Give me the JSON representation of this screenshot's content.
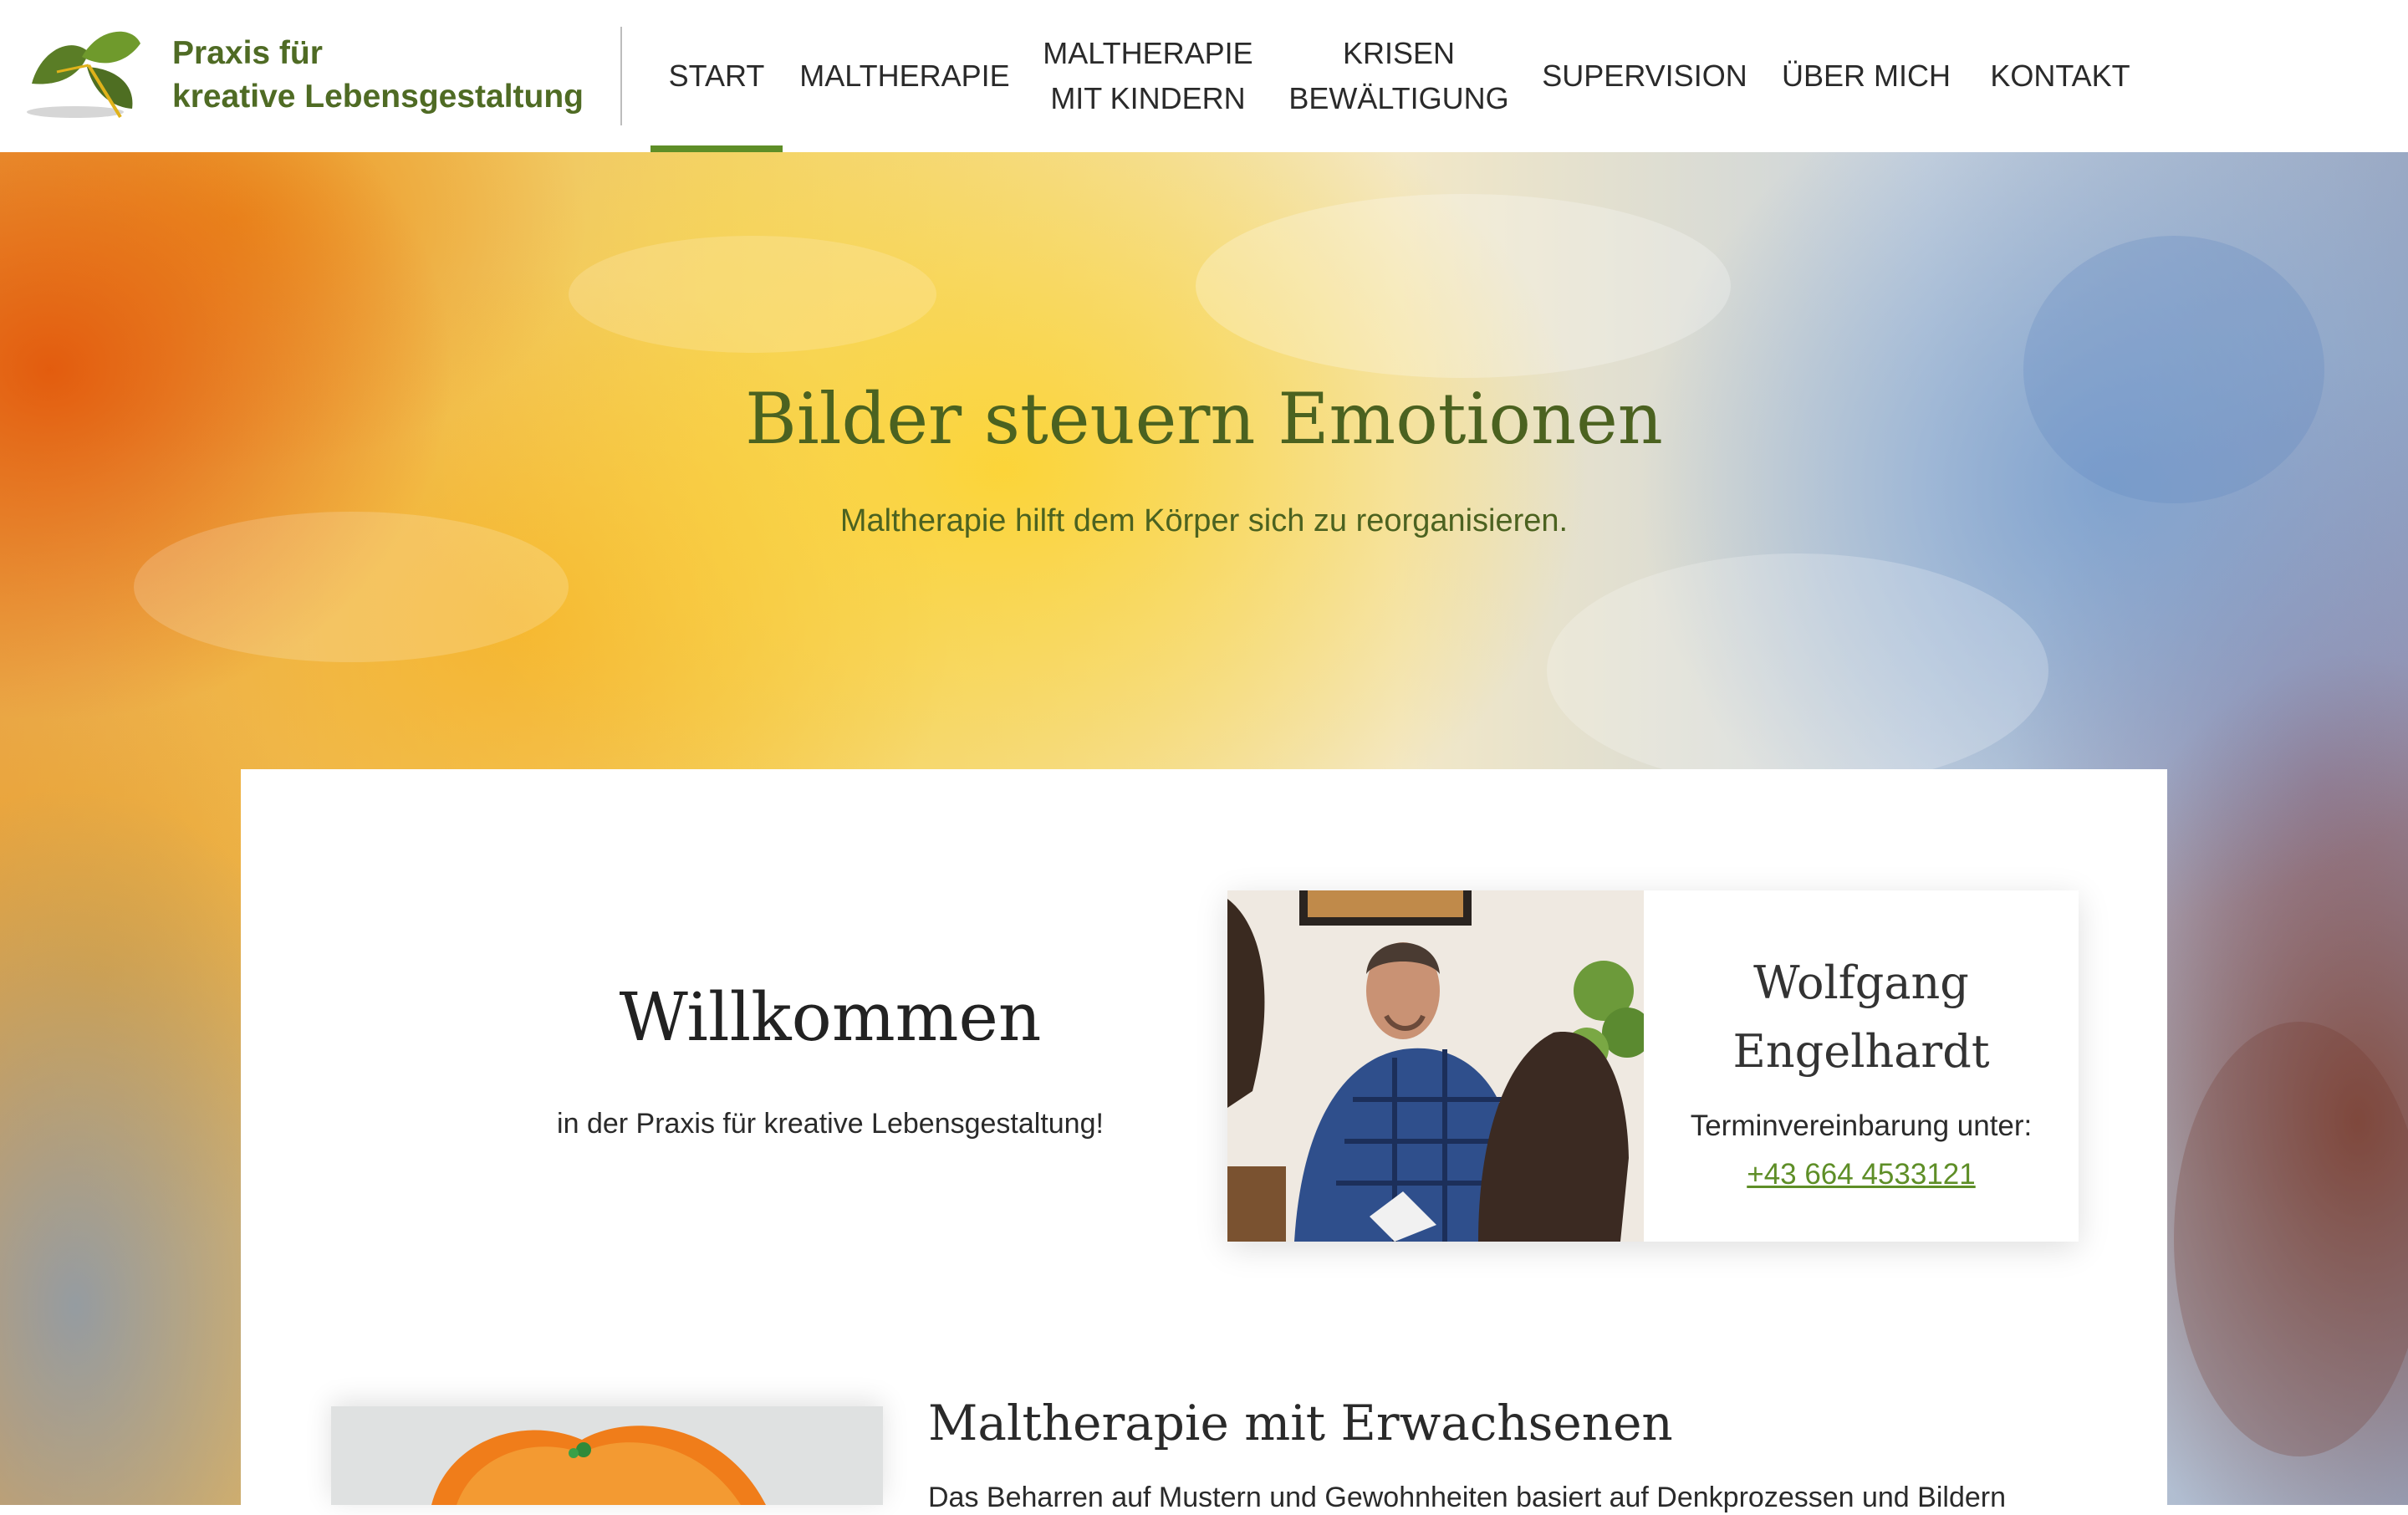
{
  "header": {
    "logo_line1": "Praxis für",
    "logo_line2": "kreative Lebensgestaltung",
    "logo_icon": "ginkgo-leaf-icon",
    "nav": [
      {
        "id": "start",
        "lines": [
          "START"
        ],
        "active": true
      },
      {
        "id": "maltherapie",
        "lines": [
          "MALTHERAPIE"
        ]
      },
      {
        "id": "maltherapie-kinder",
        "lines": [
          "MALTHERAPIE",
          "MIT KINDERN"
        ]
      },
      {
        "id": "krisen",
        "lines": [
          "KRISEN",
          "BEWÄLTIGUNG"
        ]
      },
      {
        "id": "supervision",
        "lines": [
          "SUPERVISION"
        ]
      },
      {
        "id": "ueber-mich",
        "lines": [
          "ÜBER MICH"
        ]
      },
      {
        "id": "kontakt",
        "lines": [
          "KONTAKT"
        ]
      }
    ]
  },
  "hero": {
    "title": "Bilder steuern Emotionen",
    "subtitle": "Maltherapie hilft dem Körper sich zu reorganisieren."
  },
  "welcome": {
    "title": "Willkommen",
    "subtitle": "in der Praxis für kreative Lebensgestaltung!"
  },
  "contact": {
    "name_line1": "Wolfgang",
    "name_line2": "Engelhardt",
    "label": "Terminvereinbarung unter:",
    "phone": "+43 664 4533121"
  },
  "section": {
    "title": "Maltherapie mit Erwachsenen",
    "text": "Das Beharren auf Mustern und Gewohnheiten basiert auf Denkprozessen und Bildern"
  },
  "colors": {
    "accent_green": "#5e8e27",
    "logo_green": "#4f6b24",
    "hero_text": "#4b6220"
  }
}
